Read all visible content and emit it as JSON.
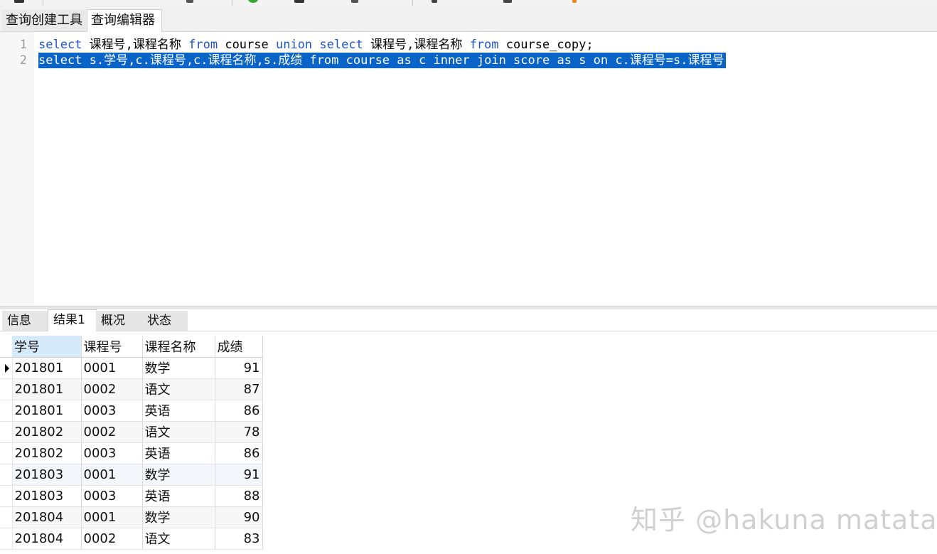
{
  "editor_tabs": [
    "查询创建工具",
    "查询编辑器"
  ],
  "editor": {
    "line_numbers": [
      "1",
      "2"
    ],
    "line1": {
      "k1": "select",
      "t1": " 课程号,课程名称 ",
      "k2": "from",
      "t2": " course ",
      "k3": "union",
      "t3": " ",
      "k4": "select",
      "t4": " 课程号,课程名称 ",
      "k5": "from",
      "t5": " course_copy;"
    },
    "line2": "select s.学号,c.课程号,c.课程名称,s.成绩 from course as c inner join score as s on c.课程号=s.课程号"
  },
  "result_tabs": [
    "信息",
    "结果1",
    "概况",
    "状态"
  ],
  "result": {
    "columns": [
      "学号",
      "课程号",
      "课程名称",
      "成绩"
    ],
    "rows": [
      [
        "201801",
        "0001",
        "数学",
        "91"
      ],
      [
        "201801",
        "0002",
        "语文",
        "87"
      ],
      [
        "201801",
        "0003",
        "英语",
        "86"
      ],
      [
        "201802",
        "0002",
        "语文",
        "78"
      ],
      [
        "201802",
        "0003",
        "英语",
        "86"
      ],
      [
        "201803",
        "0001",
        "数学",
        "91"
      ],
      [
        "201803",
        "0003",
        "英语",
        "88"
      ],
      [
        "201804",
        "0001",
        "数学",
        "90"
      ],
      [
        "201804",
        "0002",
        "语文",
        "83"
      ]
    ]
  },
  "watermark": "知乎 @hakuna matata",
  "colors": {
    "keyword": "#1f57c7",
    "selection": "#0a64c8",
    "sorted_header": "#d7eafb"
  }
}
